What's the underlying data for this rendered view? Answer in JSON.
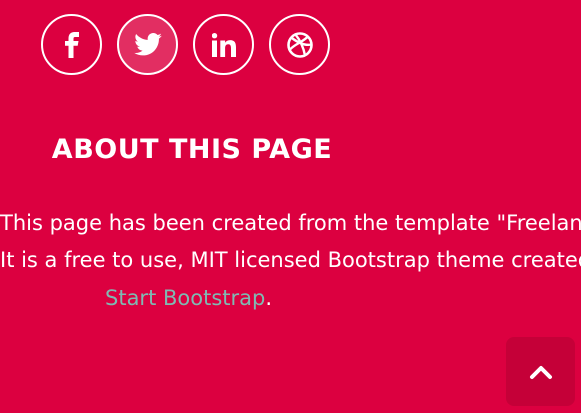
{
  "social": {
    "buttons": [
      {
        "icon": "facebook-icon"
      },
      {
        "icon": "twitter-icon"
      },
      {
        "icon": "linkedin-icon"
      },
      {
        "icon": "dribbble-icon"
      }
    ]
  },
  "about": {
    "heading": "ABOUT THIS PAGE",
    "line1": "This page has been created from the template \"Freelance\".",
    "line2": "It is a free to use, MIT licensed Bootstrap theme created by",
    "link_text": "Start Bootstrap",
    "trailing": "."
  },
  "scroll_top": {
    "icon": "chevron-up-icon"
  },
  "colors": {
    "background": "#dc0040",
    "link": "#7fbab3",
    "scroll_button": "#c50038"
  }
}
